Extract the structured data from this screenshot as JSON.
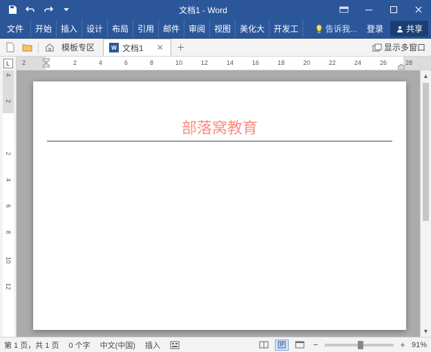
{
  "title": "文档1 - Word",
  "qat": {
    "save": "保存",
    "undo": "撤销",
    "redo": "重做"
  },
  "ribbon": {
    "file": "文件",
    "tabs": [
      "开始",
      "插入",
      "设计",
      "布局",
      "引用",
      "邮件",
      "审阅",
      "视图",
      "美化大",
      "开发工"
    ],
    "tellme": "告诉我...",
    "login": "登录",
    "share": "共享"
  },
  "tabbar": {
    "template_zone": "模板专区",
    "doc_name": "文档1",
    "multi_window": "显示多窗口"
  },
  "ruler": {
    "marks": [
      "2",
      "",
      "2",
      "4",
      "6",
      "8",
      "10",
      "12",
      "14",
      "16",
      "18",
      "20",
      "22",
      "24",
      "26",
      "28"
    ]
  },
  "vruler": {
    "marks": [
      "4",
      "2",
      "",
      "2",
      "4",
      "6",
      "8",
      "10",
      "12"
    ]
  },
  "document": {
    "header_text": "部落窝教育"
  },
  "status": {
    "page": "第 1 页，共 1 页",
    "words": "0 个字",
    "lang": "中文(中国)",
    "mode": "插入",
    "zoom": "91%"
  }
}
